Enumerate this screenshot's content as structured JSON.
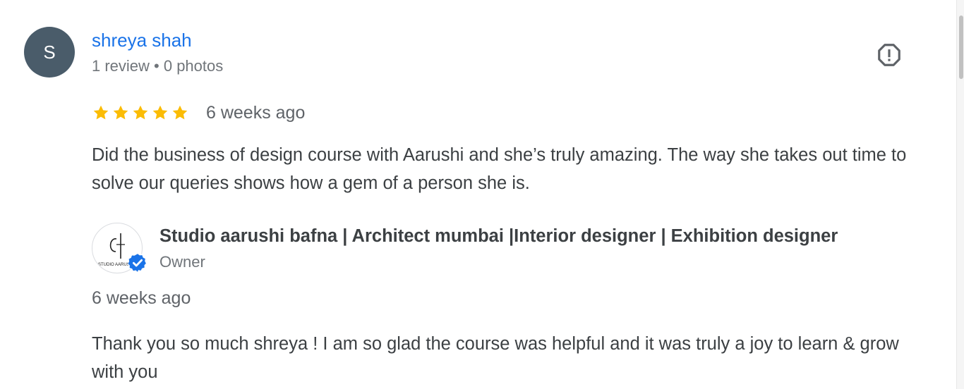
{
  "review": {
    "avatar_initial": "S",
    "reviewer_name": "shreya shah",
    "reviewer_meta": "1 review • 0 photos",
    "rating": 5,
    "rating_max": 5,
    "date": "6 weeks ago",
    "text": "Did the business of design course with Aarushi and she’s truly amazing. The way she takes out time to solve our queries shows how a gem of a person she is.",
    "flag_icon": "report-flag-icon"
  },
  "owner_reply": {
    "logo_text": "STUDIO AARUSHI",
    "owner_name": "Studio aarushi bafna | Architect mumbai |Interior designer | Exhibition designer",
    "owner_role": "Owner",
    "date": "6 weeks ago",
    "text": "Thank you so much shreya ! I am so glad the course was helpful and it was truly a joy to learn & grow with you",
    "verified_icon": "verified-badge-icon"
  },
  "colors": {
    "name_link": "#1a73e8",
    "avatar_bg": "#4a5c6a",
    "star": "#fbbc04",
    "verified": "#1a73e8",
    "text": "#3c4043",
    "muted": "#70757a"
  }
}
